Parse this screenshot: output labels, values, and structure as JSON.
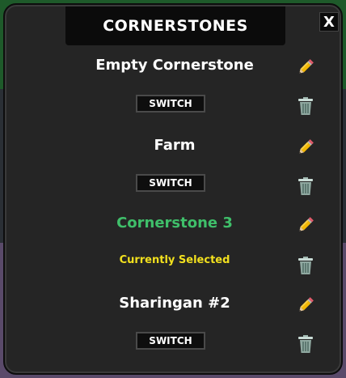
{
  "window": {
    "title": "CORNERSTONES",
    "close_label": "X"
  },
  "colors": {
    "panel": "#252525",
    "selected_name": "#3fbf6a",
    "selected_label": "#f2e01e"
  },
  "slots": [
    {
      "name": "Empty Cornerstone",
      "action_label": "SWITCH",
      "selected": false
    },
    {
      "name": "Farm",
      "action_label": "SWITCH",
      "selected": false
    },
    {
      "name": "Cornerstone 3",
      "action_label": "Currently Selected",
      "selected": true
    },
    {
      "name": "Sharingan #2",
      "action_label": "SWITCH",
      "selected": false
    }
  ],
  "icons": {
    "rename": "pencil-icon",
    "delete": "trash-icon"
  }
}
